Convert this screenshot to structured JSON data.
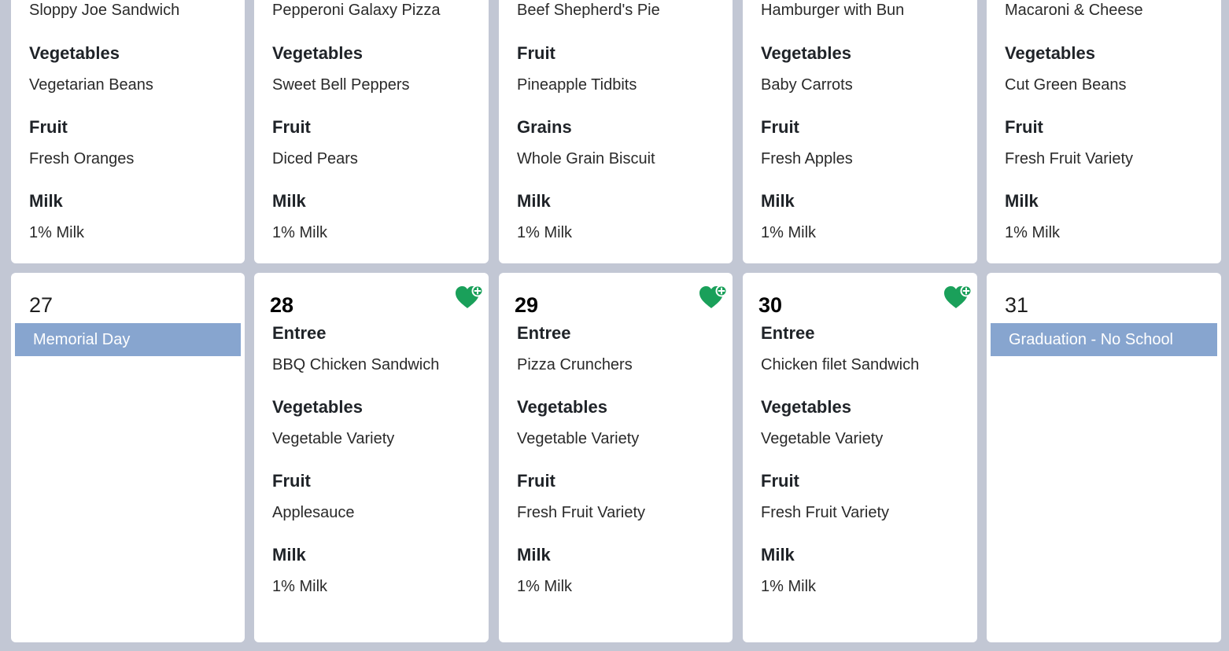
{
  "colors": {
    "background": "#c2c7d4",
    "card": "#ffffff",
    "event_bar": "#87a5cf",
    "heart": "#1aa05a"
  },
  "week1": [
    {
      "sections": [
        {
          "item": "Sloppy Joe Sandwich"
        },
        {
          "head": "Vegetables",
          "item": "Vegetarian Beans"
        },
        {
          "head": "Fruit",
          "item": "Fresh Oranges"
        },
        {
          "head": "Milk",
          "item": "1% Milk"
        }
      ]
    },
    {
      "sections": [
        {
          "item": "Pepperoni Galaxy Pizza"
        },
        {
          "head": "Vegetables",
          "item": "Sweet Bell Peppers"
        },
        {
          "head": "Fruit",
          "item": "Diced Pears"
        },
        {
          "head": "Milk",
          "item": "1% Milk"
        }
      ]
    },
    {
      "sections": [
        {
          "item": "Beef Shepherd's Pie"
        },
        {
          "head": "Fruit",
          "item": "Pineapple Tidbits"
        },
        {
          "head": "Grains",
          "item": "Whole Grain Biscuit"
        },
        {
          "head": "Milk",
          "item": "1% Milk"
        }
      ]
    },
    {
      "sections": [
        {
          "item": "Hamburger with Bun"
        },
        {
          "head": "Vegetables",
          "item": "Baby Carrots"
        },
        {
          "head": "Fruit",
          "item": "Fresh Apples"
        },
        {
          "head": "Milk",
          "item": "1% Milk"
        }
      ]
    },
    {
      "sections": [
        {
          "item": "Macaroni & Cheese"
        },
        {
          "head": "Vegetables",
          "item": "Cut Green Beans"
        },
        {
          "head": "Fruit",
          "item": "Fresh Fruit Variety"
        },
        {
          "head": "Milk",
          "item": "1% Milk"
        }
      ]
    }
  ],
  "week2": [
    {
      "day": "27",
      "event": "Memorial Day"
    },
    {
      "day": "28",
      "favorite_icon": "heart-plus-icon",
      "sections": [
        {
          "head": "Entree",
          "item": "BBQ Chicken Sandwich"
        },
        {
          "head": "Vegetables",
          "item": "Vegetable Variety"
        },
        {
          "head": "Fruit",
          "item": "Applesauce"
        },
        {
          "head": "Milk",
          "item": "1% Milk"
        }
      ]
    },
    {
      "day": "29",
      "favorite_icon": "heart-plus-icon",
      "sections": [
        {
          "head": "Entree",
          "item": "Pizza Crunchers"
        },
        {
          "head": "Vegetables",
          "item": "Vegetable Variety"
        },
        {
          "head": "Fruit",
          "item": "Fresh Fruit Variety"
        },
        {
          "head": "Milk",
          "item": "1% Milk"
        }
      ]
    },
    {
      "day": "30",
      "favorite_icon": "heart-plus-icon",
      "sections": [
        {
          "head": "Entree",
          "item": "Chicken filet Sandwich"
        },
        {
          "head": "Vegetables",
          "item": "Vegetable Variety"
        },
        {
          "head": "Fruit",
          "item": "Fresh Fruit Variety"
        },
        {
          "head": "Milk",
          "item": "1% Milk"
        }
      ]
    },
    {
      "day": "31",
      "event": "Graduation - No School"
    }
  ]
}
